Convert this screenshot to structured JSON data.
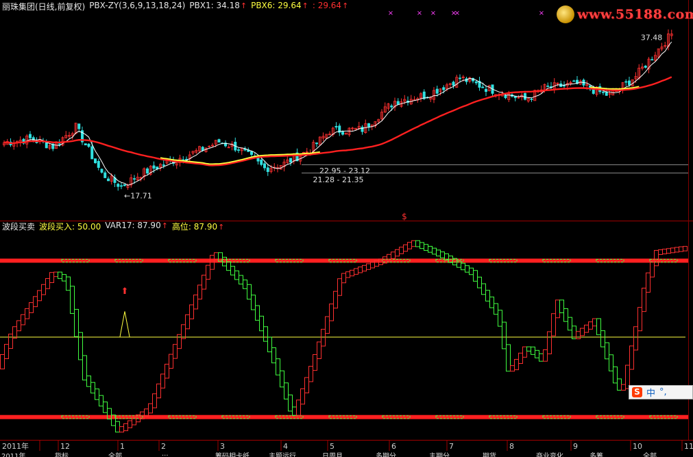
{
  "header": {
    "stock_name": "丽珠集团(日线,前复权)",
    "indicator_name": "PBX-ZY(3,6,9,13,18,24)",
    "pbx1_label": "PBX1: 34.18",
    "pbx6_label": "PBX6: 29.64",
    "extra_value": ": 29.64"
  },
  "indicator_header": {
    "title": "波段买卖",
    "buy_label": "波段买入: 50.00",
    "var_label": "VAR17: 87.90",
    "high_label": "高位: 87.90"
  },
  "logo": {
    "text": "www.55188.com"
  },
  "ime_bar": {
    "glyph": "S",
    "lang": "中",
    "sep": "°,"
  },
  "bottom_tabs": [
    "2011年",
    "指标",
    "全部",
    "...",
    "筹码相卡纸",
    "主题运行",
    "日周月",
    "多期分",
    "主期分",
    "期货",
    "商业变化",
    "多筹",
    "全部"
  ],
  "colors": {
    "up": "#ff3030",
    "down": "#40ff40",
    "ma_short": "#ffffff",
    "ma_long": "#ff2020",
    "yellow": "#ffff40",
    "grid": "#ff2020"
  },
  "chart_data": [
    {
      "type": "candlestick",
      "title": "丽珠集团(日线,前复权)",
      "ylim": [
        15,
        40
      ],
      "annotations": [
        {
          "text": "37.48",
          "type": "high",
          "index": 203
        },
        {
          "text": "17.71",
          "type": "low",
          "index": 36
        },
        {
          "text": "22.95 - 23.12",
          "type": "range",
          "index": 96
        },
        {
          "text": "21.28 - 21.35",
          "type": "range",
          "index": 94
        }
      ],
      "signal_marker": "$",
      "x_ticks": [
        "2011年",
        "12",
        "1",
        "2",
        "3",
        "4",
        "5",
        "6",
        "7",
        "8",
        "9",
        "10",
        "11"
      ],
      "ma_short_label": "PBX1: 34.18",
      "ma_long_label": "PBX6: 29.64"
    },
    {
      "type": "line",
      "title": "波段买卖",
      "ylim": [
        0,
        100
      ],
      "levels": {
        "high": 87.9,
        "mid": 50,
        "low": 10
      }
    }
  ]
}
